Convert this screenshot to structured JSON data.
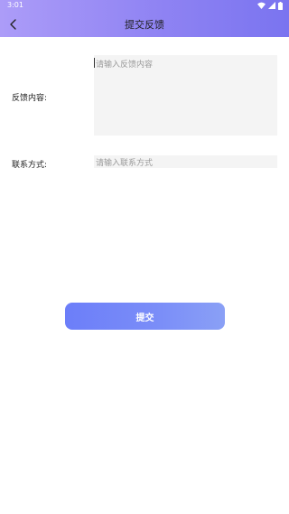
{
  "status_bar": {
    "time": "3:01",
    "icons": [
      "wifi-icon",
      "signal-icon",
      "battery-icon"
    ]
  },
  "nav": {
    "back_icon": "chevron-left-icon",
    "title": "提交反馈"
  },
  "form": {
    "content_label": "反馈内容:",
    "content_placeholder": "请输入反馈内容",
    "contact_label": "联系方式:",
    "contact_placeholder": "请输入联系方式"
  },
  "submit_label": "提交",
  "colors": {
    "header_gradient_start": "#ac9cf8",
    "header_gradient_end": "#7a74f0",
    "button_gradient_start": "#6c7ef9",
    "button_gradient_end": "#8aa0f6",
    "field_background": "#f4f4f4",
    "placeholder_text": "#9a9a9a"
  }
}
